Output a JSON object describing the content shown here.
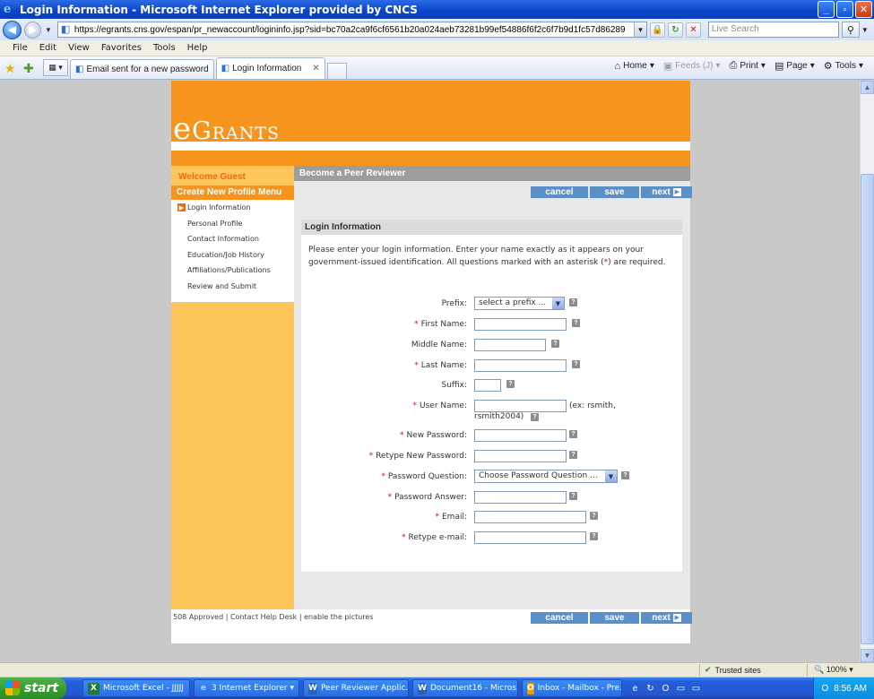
{
  "window": {
    "title": "Login Information - Microsoft Internet Explorer provided by CNCS",
    "buttons": [
      "_",
      "□",
      "X"
    ]
  },
  "address": {
    "url": "https://egrants.cns.gov/espan/pr_newaccount/logininfo.jsp?sid=bc70a2ca9f6cf6561b20a024aeb73281b99ef54886f6f2c6f7b9d1fc57d86289",
    "search_placeholder": "Live Search"
  },
  "menubar": [
    "File",
    "Edit",
    "View",
    "Favorites",
    "Tools",
    "Help"
  ],
  "tabs": [
    {
      "label": "Email sent for a new password",
      "active": false
    },
    {
      "label": "Login Information",
      "active": true
    }
  ],
  "commands": {
    "home": "Home",
    "feeds": "Feeds (J)",
    "print": "Print",
    "page": "Page",
    "tools": "Tools"
  },
  "site": {
    "logo_first": "e",
    "logo_rest": "Grants",
    "welcome": "Welcome Guest",
    "menu_title": "Create New Profile Menu",
    "menu_items": [
      "Login Information",
      "Personal Profile",
      "Contact Information",
      "Education/Job History",
      "Affiliations/Publications",
      "Review and Submit"
    ],
    "section_title": "Become a Peer Reviewer",
    "actions": {
      "cancel": "cancel",
      "save": "save",
      "next": "next"
    },
    "panel_title": "Login Information",
    "intro_1": "Please enter your login information.  Enter your name exactly as it appears on your",
    "intro_2a": "government-issued identification.  All questions marked with an asterisk (",
    "intro_star": "*",
    "intro_2b": ") are required.",
    "fields": {
      "prefix": {
        "label": "Prefix:",
        "value": "select a prefix ..."
      },
      "first_name": {
        "label": "First Name:"
      },
      "middle_name": {
        "label": "Middle Name:"
      },
      "last_name": {
        "label": "Last Name:"
      },
      "suffix": {
        "label": "Suffix:"
      },
      "user_name": {
        "label": "User Name:",
        "hint_1": "(ex: rsmith,",
        "hint_2": "rsmith2004)"
      },
      "new_password": {
        "label": "New Password:"
      },
      "retype_password": {
        "label": "Retype New Password:"
      },
      "password_question": {
        "label": "Password Question:",
        "value": "Choose Password Question ..."
      },
      "password_answer": {
        "label": "Password Answer:"
      },
      "email": {
        "label": "Email:"
      },
      "retype_email": {
        "label": "Retype e-mail:"
      }
    },
    "footer": "508 Approved  | Contact Help Desk  | enable the pictures"
  },
  "status": {
    "zone": "Trusted sites",
    "zoom": "100%"
  },
  "taskbar": {
    "start": "start",
    "items": [
      "Microsoft Excel - JJJJJ",
      "3 Internet Explorer",
      "Peer Reviewer Applic...",
      "Document16 - Micros...",
      "Inbox - Mailbox - Pre..."
    ],
    "clock": "8:56 AM"
  },
  "colors": {
    "orange": "#f7941d",
    "light_orange": "#ffc65c",
    "button_blue": "#5b8fc8",
    "required_red": "#d01414"
  }
}
